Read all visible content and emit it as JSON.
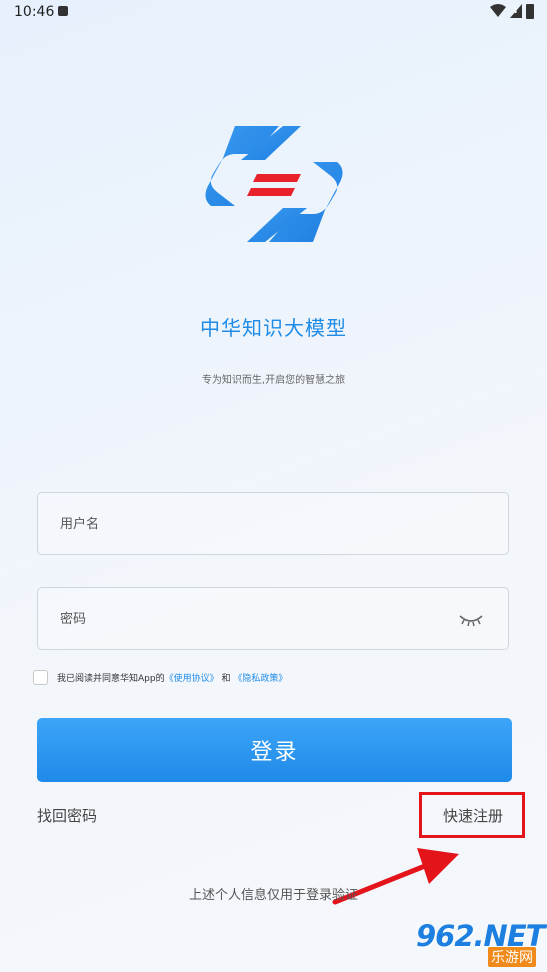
{
  "status_bar": {
    "time": "10:46"
  },
  "app": {
    "title": "中华知识大模型",
    "subtitle": "专为知识而生,开启您的智慧之旅"
  },
  "form": {
    "username_placeholder": "用户名",
    "password_placeholder": "密码",
    "agreement_prefix": "我已阅读并同意华知App的",
    "terms_link": "《使用协议》",
    "agreement_and": "和",
    "privacy_link": "《隐私政策》",
    "login_label": "登录",
    "forgot_password": "找回密码",
    "quick_register": "快速注册"
  },
  "footer": {
    "note": "上述个人信息仅用于登录验证"
  },
  "watermark": {
    "big": "962.NET",
    "small": "乐游网"
  },
  "colors": {
    "accent": "#1f8ce8",
    "highlight": "#e3141a",
    "logo_red": "#e8212b"
  }
}
